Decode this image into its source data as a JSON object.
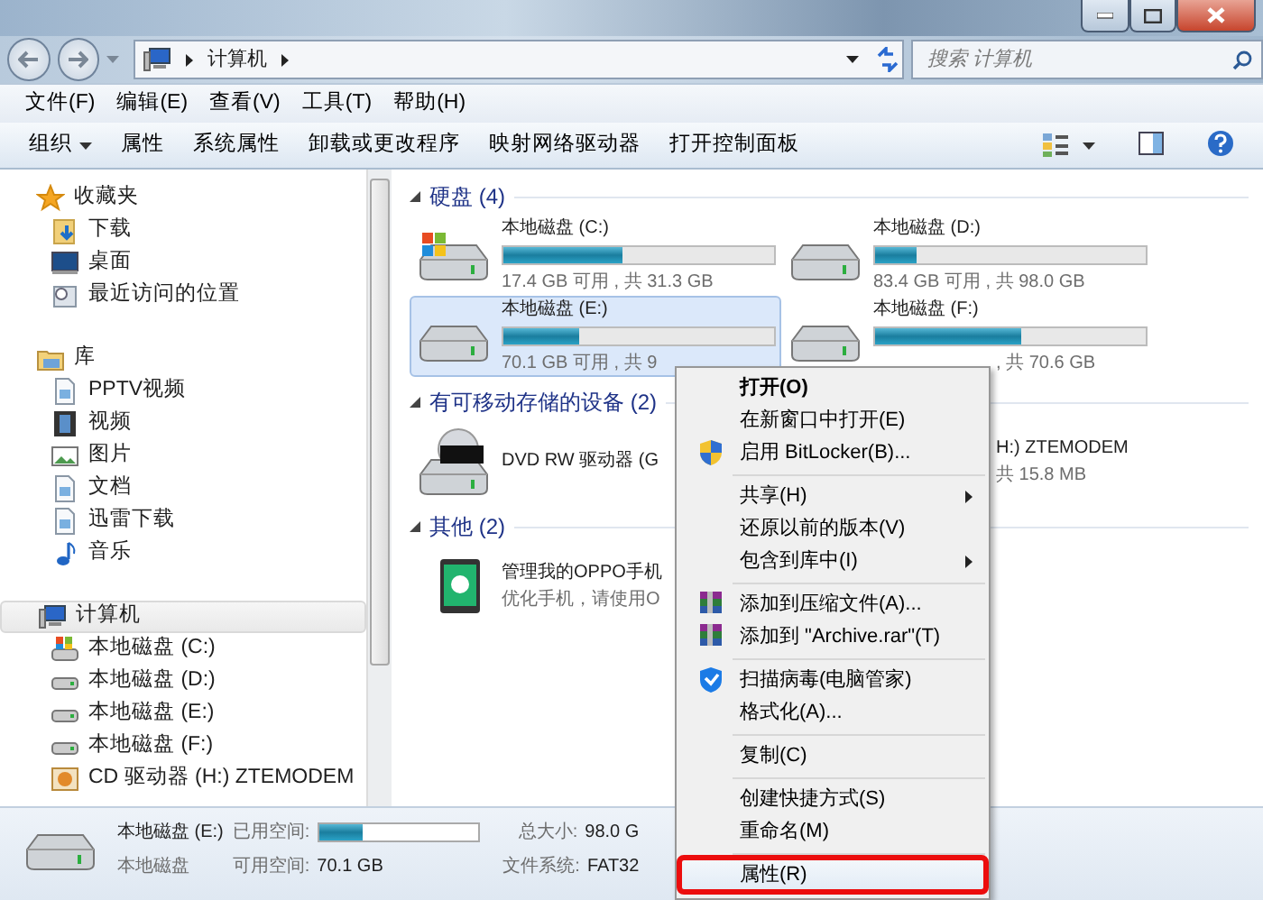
{
  "address": {
    "crumbs": [
      "计算机"
    ]
  },
  "search": {
    "placeholder": "搜索 计算机"
  },
  "menubar": [
    "文件(F)",
    "编辑(E)",
    "查看(V)",
    "工具(T)",
    "帮助(H)"
  ],
  "toolbar": [
    {
      "label": "组织",
      "dropdown": true
    },
    {
      "label": "属性",
      "dropdown": false
    },
    {
      "label": "系统属性",
      "dropdown": false
    },
    {
      "label": "卸载或更改程序",
      "dropdown": false
    },
    {
      "label": "映射网络驱动器",
      "dropdown": false
    },
    {
      "label": "打开控制面板",
      "dropdown": false
    }
  ],
  "sidebar": {
    "groups": [
      {
        "label": "收藏夹",
        "kind": "star",
        "selected": false,
        "children": [
          {
            "label": "下载",
            "kind": "download",
            "selected": false
          },
          {
            "label": "桌面",
            "kind": "desktop",
            "selected": false
          },
          {
            "label": "最近访问的位置",
            "kind": "recent",
            "selected": false
          }
        ]
      },
      {
        "label": "库",
        "kind": "library",
        "selected": false,
        "children": [
          {
            "label": "PPTV视频",
            "kind": "doc",
            "selected": false
          },
          {
            "label": "视频",
            "kind": "film",
            "selected": false
          },
          {
            "label": "图片",
            "kind": "picture",
            "selected": false
          },
          {
            "label": "文档",
            "kind": "doc",
            "selected": false
          },
          {
            "label": "迅雷下载",
            "kind": "doc",
            "selected": false
          },
          {
            "label": "音乐",
            "kind": "music",
            "selected": false
          }
        ]
      },
      {
        "label": "计算机",
        "kind": "computer",
        "selected": true,
        "children": [
          {
            "label": "本地磁盘 (C:)",
            "kind": "system-drive",
            "selected": false
          },
          {
            "label": "本地磁盘 (D:)",
            "kind": "drive",
            "selected": false
          },
          {
            "label": "本地磁盘 (E:)",
            "kind": "drive",
            "selected": false
          },
          {
            "label": "本地磁盘 (F:)",
            "kind": "drive",
            "selected": false
          },
          {
            "label": "CD 驱动器 (H:) ZTEMODEM",
            "kind": "cd-drive",
            "selected": false
          }
        ]
      }
    ]
  },
  "groups": [
    {
      "title": "硬盘 (4)",
      "expanded": true,
      "items": [
        {
          "kind": "system-drive",
          "name": "本地磁盘 (C:)",
          "level": 0.44,
          "caption": "17.4 GB 可用 , 共 31.3 GB",
          "selected": false,
          "covered": false
        },
        {
          "kind": "drive",
          "name": "本地磁盘 (D:)",
          "level": 0.15,
          "caption": "83.4 GB 可用 , 共 98.0 GB",
          "selected": false,
          "covered": false
        },
        {
          "kind": "drive",
          "name": "本地磁盘 (E:)",
          "level": 0.28,
          "caption": "70.1 GB 可用 , 共 9",
          "selected": true,
          "covered": false
        },
        {
          "kind": "drive",
          "name": "本地磁盘 (F:)",
          "level": 0.54,
          "caption": ", 共 70.6 GB",
          "selected": false,
          "covered": false,
          "caption_covered": true
        }
      ]
    },
    {
      "title": "有可移动存储的设备 (2)",
      "expanded": true,
      "items": [
        {
          "kind": "dvd",
          "name": "DVD RW 驱动器 (G",
          "selected": false,
          "covered": false
        },
        {
          "name": "H:) ZTEMODEM",
          "caption": "共 15.8 MB",
          "selected": false,
          "covered": true
        }
      ]
    },
    {
      "title": "其他 (2)",
      "expanded": true,
      "items": [
        {
          "kind": "phone",
          "name": "管理我的OPPO手机",
          "caption": "优化手机，请使用O",
          "selected": false,
          "covered": false
        }
      ]
    }
  ],
  "details": {
    "name": "本地磁盘 (E:)",
    "type": "本地磁盘",
    "used_label": "已用空间:",
    "level": 0.28,
    "free_label": "可用空间:",
    "free": "70.1 GB",
    "total_label": "总大小:",
    "total": "98.0 G",
    "fs_label": "文件系统:",
    "fs": "FAT32"
  },
  "context_menu": [
    [
      {
        "label": "打开(O)",
        "kind": "default",
        "submenu": false,
        "selected": false,
        "annotated": false
      },
      {
        "label": "在新窗口中打开(E)",
        "kind": "plain",
        "submenu": false,
        "selected": false,
        "annotated": false
      },
      {
        "label": "启用 BitLocker(B)...",
        "kind": "shield",
        "submenu": false,
        "selected": false,
        "annotated": false
      }
    ],
    [
      {
        "label": "共享(H)",
        "kind": "plain",
        "submenu": true,
        "selected": false,
        "annotated": false
      },
      {
        "label": "还原以前的版本(V)",
        "kind": "plain",
        "submenu": false,
        "selected": false,
        "annotated": false
      },
      {
        "label": "包含到库中(I)",
        "kind": "plain",
        "submenu": true,
        "selected": false,
        "annotated": false
      }
    ],
    [
      {
        "label": "添加到压缩文件(A)...",
        "kind": "archive",
        "submenu": false,
        "selected": false,
        "annotated": false
      },
      {
        "label": "添加到 \"Archive.rar\"(T)",
        "kind": "archive",
        "submenu": false,
        "selected": false,
        "annotated": false
      }
    ],
    [
      {
        "label": "扫描病毒(电脑管家)",
        "kind": "guard",
        "submenu": false,
        "selected": false,
        "annotated": false
      },
      {
        "label": "格式化(A)...",
        "kind": "plain",
        "submenu": false,
        "selected": false,
        "annotated": false
      }
    ],
    [
      {
        "label": "复制(C)",
        "kind": "plain",
        "submenu": false,
        "selected": false,
        "annotated": false
      }
    ],
    [
      {
        "label": "创建快捷方式(S)",
        "kind": "plain",
        "submenu": false,
        "selected": false,
        "annotated": false
      },
      {
        "label": "重命名(M)",
        "kind": "plain",
        "submenu": false,
        "selected": false,
        "annotated": false
      }
    ],
    [
      {
        "label": "属性(R)",
        "kind": "plain",
        "submenu": false,
        "selected": true,
        "annotated": true
      }
    ]
  ]
}
